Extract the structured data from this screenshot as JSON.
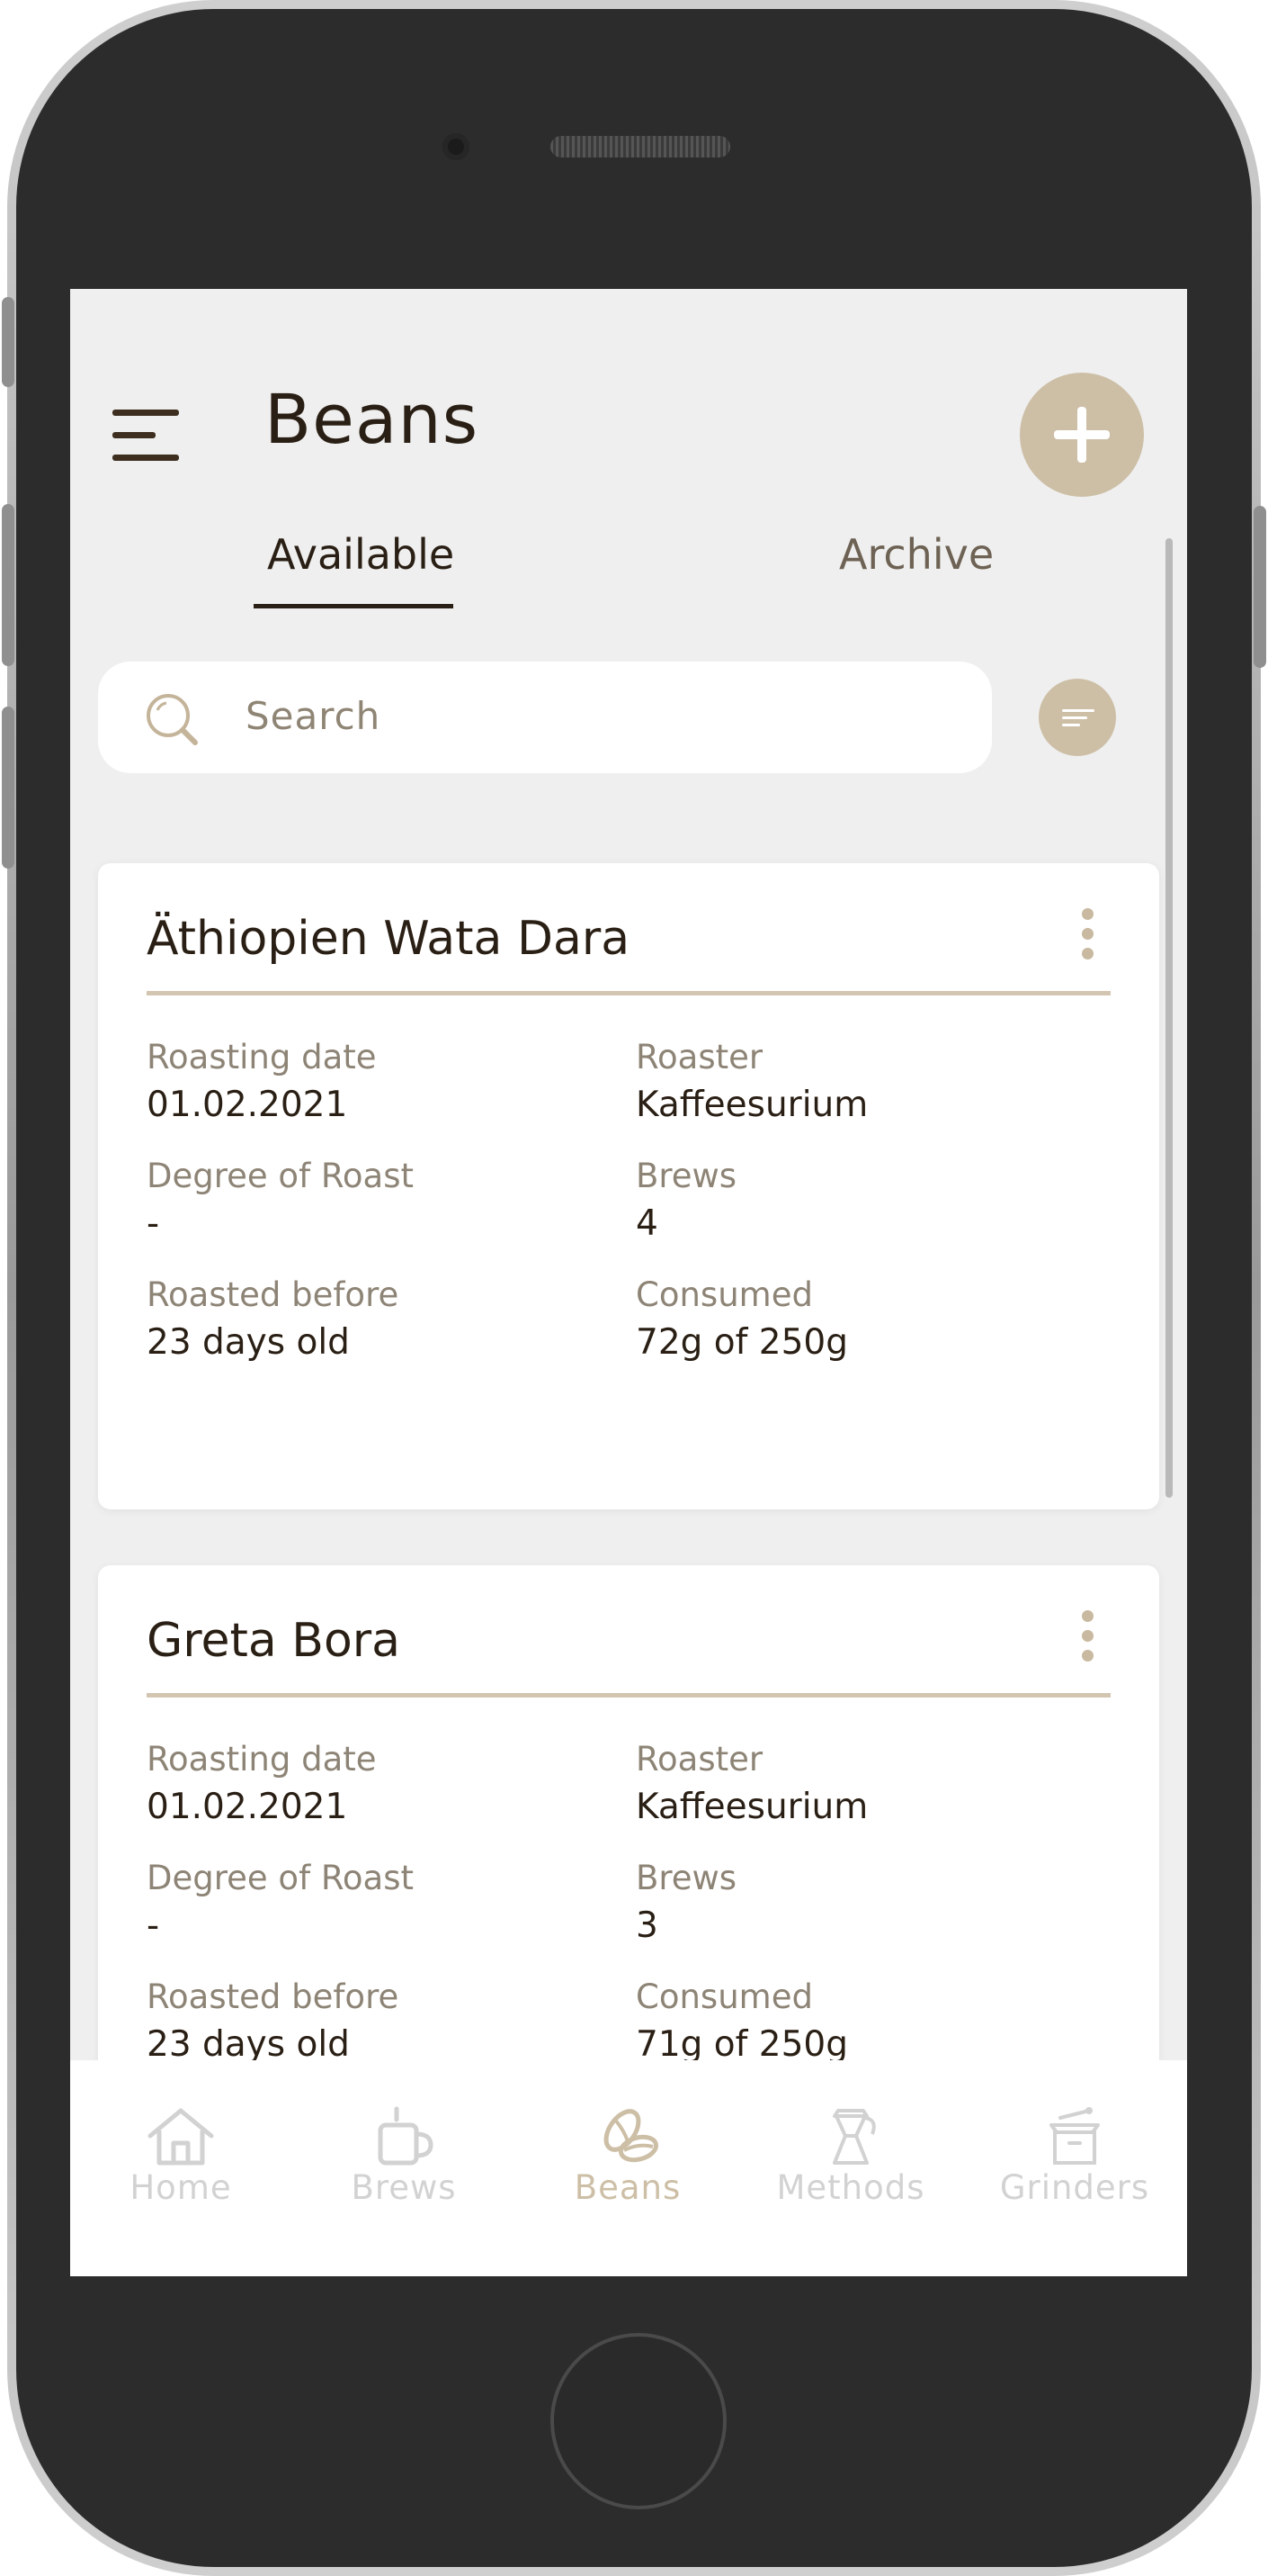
{
  "header": {
    "title": "Beans"
  },
  "tabs": [
    {
      "label": "Available",
      "active": true
    },
    {
      "label": "Archive",
      "active": false
    }
  ],
  "search": {
    "placeholder": "Search",
    "value": ""
  },
  "cards": [
    {
      "name": "Äthiopien Wata Dara",
      "fields": [
        {
          "label": "Roasting date",
          "value": "01.02.2021"
        },
        {
          "label": "Roaster",
          "value": "Kaffeesurium"
        },
        {
          "label": "Degree of Roast",
          "value": "-"
        },
        {
          "label": "Brews",
          "value": "4"
        },
        {
          "label": "Roasted before",
          "value": "23 days old"
        },
        {
          "label": "Consumed",
          "value": "72g of 250g"
        }
      ]
    },
    {
      "name": "Greta Bora",
      "fields": [
        {
          "label": "Roasting date",
          "value": "01.02.2021"
        },
        {
          "label": "Roaster",
          "value": "Kaffeesurium"
        },
        {
          "label": "Degree of Roast",
          "value": "-"
        },
        {
          "label": "Brews",
          "value": "3"
        },
        {
          "label": "Roasted before",
          "value": "23 days old"
        },
        {
          "label": "Consumed",
          "value": "71g of 250g"
        }
      ]
    }
  ],
  "nav": [
    {
      "label": "Home",
      "icon": "home-icon",
      "active": false
    },
    {
      "label": "Brews",
      "icon": "cup-icon",
      "active": false
    },
    {
      "label": "Beans",
      "icon": "bean-icon",
      "active": true
    },
    {
      "label": "Methods",
      "icon": "moka-pot-icon",
      "active": false
    },
    {
      "label": "Grinders",
      "icon": "grinder-icon",
      "active": false
    }
  ],
  "colors": {
    "accent": "#cdbfa6",
    "text_dark": "#2a1f14",
    "text_muted": "#8d8476",
    "background": "#efefef",
    "nav_inactive": "#d2d2d2"
  }
}
